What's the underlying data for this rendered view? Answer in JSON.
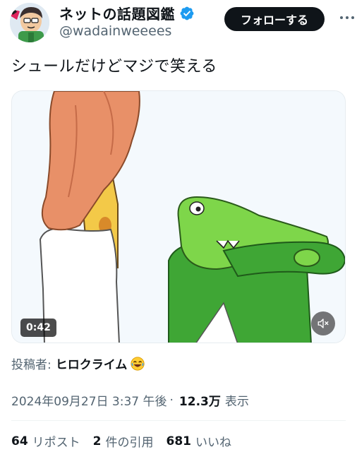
{
  "author": {
    "display_name": "ネットの話題図鑑",
    "handle": "@wadainweeees",
    "follow_label": "フォローする"
  },
  "tweet": {
    "text": "シュールだけどマジで笑える"
  },
  "media": {
    "duration": "0:42",
    "muted": true
  },
  "poster": {
    "label": "投稿者:",
    "name": "ヒロクライム"
  },
  "meta": {
    "datetime": "2024年09月27日 3:37 午後",
    "views": "12.3万",
    "views_label": "表示"
  },
  "stats": {
    "reposts": "64",
    "reposts_label": "リポスト",
    "quotes": "2",
    "quotes_label": "件の引用",
    "likes": "681",
    "likes_label": "いいね"
  },
  "colors": {
    "text": "#0f1419",
    "secondary": "#536471",
    "verified": "#1d9bf0",
    "button_bg": "#0f1419",
    "shirt_orange": "#e89068",
    "crocodile_green": "#7ed64a",
    "shirt_green": "#3fa635"
  }
}
